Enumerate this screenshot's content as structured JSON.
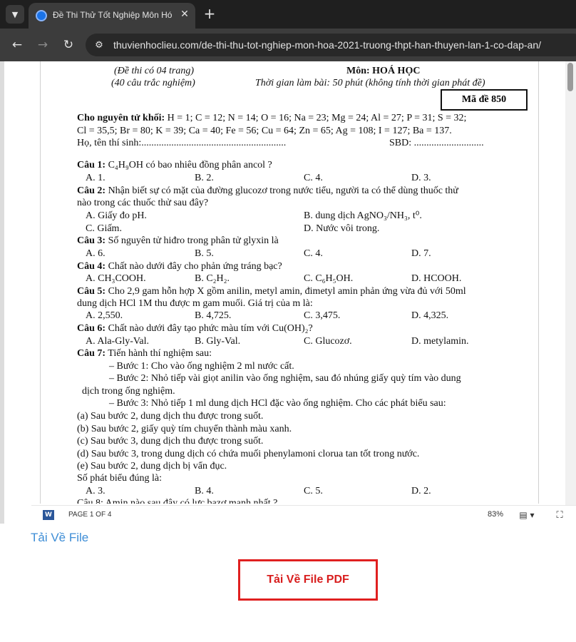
{
  "browser": {
    "tab_title": "Đề Thi Thử Tốt Nghiệp Môn Hó",
    "url": "thuvienhoclieu.com/de-thi-thu-tot-nghiep-mon-hoa-2021-truong-thpt-han-thuyen-lan-1-co-dap-an/"
  },
  "doc": {
    "header_left_1": "(Đề thi có 04 trang)",
    "header_left_2": "(40 câu trắc nghiệm)",
    "subject_label": "Môn: HOÁ HỌC",
    "time_label": "Thời gian làm bài: 50 phút (không tính thời gian phát đề)",
    "exam_code": "Mã đề 850",
    "atomic_label": "Cho nguyên tử khối:",
    "atomic_line1": " H = 1; C = 12; N = 14; O = 16; Na = 23; Mg = 24; Al = 27; P = 31; S = 32;",
    "atomic_line2": "Cl = 35,5;  Br = 80; K = 39; Ca = 40; Fe = 56; Cu = 64; Zn = 65; Ag = 108;  I = 127; Ba = 137.",
    "name_line": "Họ, tên thí sinh:..........................................................",
    "sbd_line": "SBD: ............................",
    "q1": {
      "label": "Câu 1:",
      "text": " C₄H₉OH có bao nhiêu đồng phân ancol ?",
      "a": "A. 1.",
      "b": "B. 2.",
      "c": "C. 4.",
      "d": "D. 3."
    },
    "q2": {
      "label": "Câu 2:",
      "text1": " Nhận biết sự có mặt của đường glucozơ trong nước tiểu, người ta có thể dùng thuốc thử",
      "text2": "nào trong các thuốc thử sau đây?",
      "a": "A. Giấy đo pH.",
      "b": "B. dung dịch AgNO₃/NH₃, t⁰.",
      "c": "C. Giấm.",
      "d": "D. Nước vôi trong."
    },
    "q3": {
      "label": "Câu 3:",
      "text": " Số nguyên tử hiđro trong phân tử glyxin là",
      "a": "A. 6.",
      "b": "B. 5.",
      "c": "C. 4.",
      "d": "D. 7."
    },
    "q4": {
      "label": "Câu 4:",
      "text": " Chất nào dưới đây cho phản ứng tráng bạc?",
      "a": "A. CH₃COOH.",
      "b": "B. C₂H₂.",
      "c": "C. C₆H₅OH.",
      "d": "D. HCOOH."
    },
    "q5": {
      "label": "Câu 5:",
      "text1": " Cho 2,9 gam hỗn hợp X gồm anilin, metyl amin, đimetyl amin phản ứng vừa đủ với 50ml",
      "text2": "dung dịch HCl 1M thu được m gam muối. Giá trị của m là:",
      "a": "A. 2,550.",
      "b": "B. 4,725.",
      "c": "C. 3,475.",
      "d": "D. 4,325."
    },
    "q6": {
      "label": "Câu 6:",
      "text": " Chất nào dưới đây tạo phức màu tím với Cu(OH)₂?",
      "a": "A. Ala-Gly-Val.",
      "b": "B. Gly-Val.",
      "c": "C. Glucozơ.",
      "d": "D. metylamin."
    },
    "q7": {
      "label": "Câu 7:",
      "text": " Tiến hành thí nghiệm sau:",
      "step1": "– Bước 1: Cho vào ống nghiệm 2 ml nước cất.",
      "step2a": "– Bước 2: Nhỏ tiếp vài giọt anilin vào ống nghiệm, sau đó nhúng giấy quỳ tím vào dung",
      "step2b": "dịch trong ống nghiệm.",
      "step3": "– Bước 3: Nhỏ tiếp 1 ml dung dịch HCl đặc vào ống nghiệm. Cho các phát biểu sau:",
      "sa": "(a) Sau bước 2, dung dịch thu được trong suốt.",
      "sb": "(b) Sau bước 2, giấy quỳ tím chuyển thành màu xanh.",
      "sc": "(c) Sau bước 3, dung dịch thu được trong suốt.",
      "sd": "(d) Sau bước 3, trong dung dịch có chứa muối phenylamoni clorua tan tốt trong nước.",
      "se": "(e) Sau bước 2, dung dịch bị vẩn đục.",
      "count": "Số phát biểu đúng là:",
      "a": "A. 3.",
      "b": "B. 4.",
      "c": "C. 5.",
      "d": "D. 2."
    },
    "q8_partial": "Câu 8: Amin nào sau đây có lực bazơ mạnh nhất ?"
  },
  "viewer": {
    "word_icon": "W",
    "page_count": "PAGE 1 OF 4",
    "zoom": "83%"
  },
  "download": {
    "link_label": "Tải Về File",
    "pdf_button": "Tải Về File PDF"
  },
  "icons": {
    "tab_search": "chevron-down-icon",
    "favicon": "globe-icon",
    "close": "close-icon",
    "new_tab": "plus-icon",
    "back": "arrow-left-icon",
    "forward": "arrow-right-icon",
    "reload": "reload-icon",
    "site_info": "tune-icon",
    "view": "view-mode-icon",
    "fullscreen": "fullscreen-icon"
  },
  "colors": {
    "download_link": "#3d8dd6",
    "pdf_button_border": "#e02020",
    "word_blue": "#2b579a"
  }
}
